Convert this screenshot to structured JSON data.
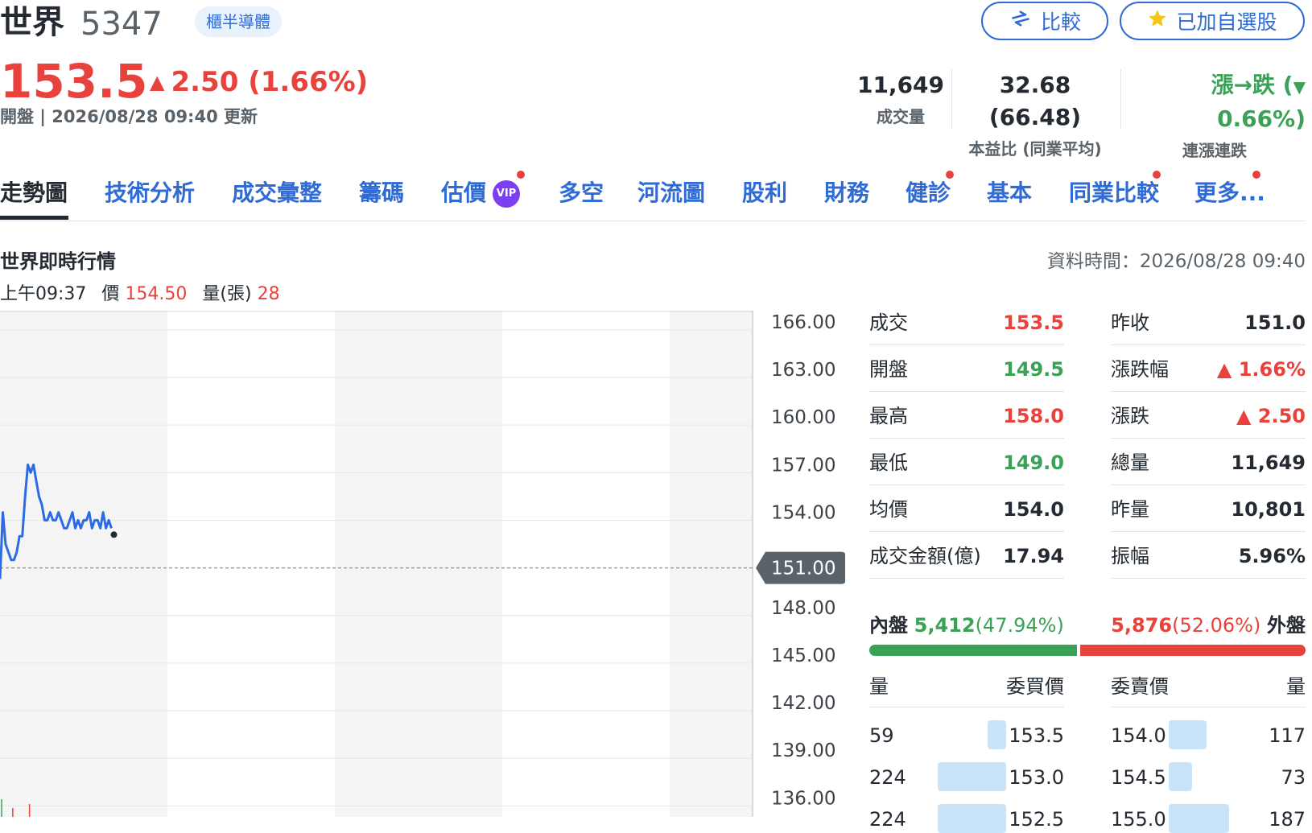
{
  "header": {
    "name": "世界",
    "code": "5347",
    "industry": "櫃半導體",
    "compare_label": "比較",
    "watchlist_label": "已加自選股",
    "price": "153.5",
    "change_arrow": "▲",
    "change": "2.50 (1.66%)",
    "update_text": "開盤 | 2026/08/28 09:40 更新",
    "volume_value": "11,649",
    "volume_label": "成交量",
    "pe_value": "32.68 (66.48)",
    "pe_label": "本益比 (同業平均)",
    "streak_value_prefix": "漲→跌 (",
    "streak_arrow": "▼",
    "streak_value_suffix": " 0.66%)",
    "streak_label": "連漲連跌"
  },
  "tabs": [
    {
      "label": "走勢圖"
    },
    {
      "label": "技術分析"
    },
    {
      "label": "成交彙整"
    },
    {
      "label": "籌碼"
    },
    {
      "label": "估價",
      "badge": "VIP"
    },
    {
      "label": "多空"
    },
    {
      "label": "河流圖"
    },
    {
      "label": "股利"
    },
    {
      "label": "財務"
    },
    {
      "label": "健診"
    },
    {
      "label": "基本"
    },
    {
      "label": "同業比較"
    },
    {
      "label": "更多..."
    }
  ],
  "section": {
    "title": "世界即時行情",
    "data_time": "資料時間：2026/08/28 09:40",
    "hover_time": "上午09:37",
    "hover_price_label": "價",
    "hover_price": "154.50",
    "hover_volume_label": "量(張)",
    "hover_volume": "28"
  },
  "quote": {
    "left": [
      {
        "label": "成交",
        "value": "153.5",
        "color": "#e8423d"
      },
      {
        "label": "開盤",
        "value": "149.5",
        "color": "#3aa157"
      },
      {
        "label": "最高",
        "value": "158.0",
        "color": "#e8423d"
      },
      {
        "label": "最低",
        "value": "149.0",
        "color": "#3aa157"
      },
      {
        "label": "均價",
        "value": "154.0",
        "color": "#232a31"
      },
      {
        "label": "成交金額(億)",
        "value": "17.94",
        "color": "#232a31"
      }
    ],
    "right": [
      {
        "label": "昨收",
        "value": "151.0",
        "color": "#232a31"
      },
      {
        "label": "漲跌幅",
        "value": "▲ 1.66%",
        "color": "#e8423d"
      },
      {
        "label": "漲跌",
        "value": "▲ 2.50",
        "color": "#e8423d"
      },
      {
        "label": "總量",
        "value": "11,649",
        "color": "#232a31"
      },
      {
        "label": "昨量",
        "value": "10,801",
        "color": "#232a31"
      },
      {
        "label": "振幅",
        "value": "5.96%",
        "color": "#232a31"
      }
    ]
  },
  "inout": {
    "in_label": "內盤",
    "in_value": "5,412",
    "in_pct": "(47.94%)",
    "out_value": "5,876",
    "out_pct": "(52.06%)",
    "out_label": "外盤",
    "in_fraction": 0.4794
  },
  "orderbook": {
    "headers": {
      "bid_qty": "量",
      "bid_price": "委買價",
      "ask_price": "委賣價",
      "ask_qty": "量"
    },
    "rows": [
      {
        "bid_qty": "59",
        "bid_price": "153.5",
        "ask_price": "154.0",
        "ask_qty": "117",
        "bid_frac": 0.16,
        "ask_frac": 0.42
      },
      {
        "bid_qty": "224",
        "bid_price": "153.0",
        "ask_price": "154.5",
        "ask_qty": "73",
        "bid_frac": 0.6,
        "ask_frac": 0.26
      },
      {
        "bid_qty": "224",
        "bid_price": "152.5",
        "ask_price": "155.0",
        "ask_qty": "187",
        "bid_frac": 0.6,
        "ask_frac": 0.67
      }
    ]
  },
  "colors": {
    "up": "#e8423d",
    "down": "#3aa157",
    "link": "#2f6bd5",
    "line": "#2b6be5"
  },
  "chart_data": {
    "type": "line",
    "yticks": [
      "166.00",
      "163.00",
      "160.00",
      "157.00",
      "154.00",
      "151.00",
      "148.00",
      "145.00",
      "142.00",
      "139.00",
      "136.00"
    ],
    "ylim": [
      134.7,
      166.6
    ],
    "reference_price": 151.0,
    "reference_label": "151.00",
    "x_minutes": [
      0,
      1,
      2,
      3,
      4,
      5,
      6,
      7,
      8,
      9,
      10,
      11,
      12,
      13,
      14,
      15,
      16,
      17,
      18,
      19,
      20,
      21,
      22,
      23,
      24,
      25,
      26,
      27,
      28,
      29,
      30,
      31,
      32,
      33,
      34,
      35,
      36,
      37,
      38,
      39,
      40
    ],
    "prices": [
      150.3,
      154.5,
      152.5,
      152.0,
      151.5,
      151.5,
      152.0,
      153.0,
      153.0,
      155.5,
      157.5,
      157.0,
      157.5,
      156.5,
      155.5,
      155.0,
      154.0,
      154.0,
      154.5,
      154.0,
      154.0,
      154.5,
      154.0,
      153.5,
      153.5,
      154.0,
      154.5,
      153.5,
      154.0,
      153.5,
      154.0,
      154.0,
      154.5,
      153.5,
      154.0,
      154.0,
      153.5,
      154.5,
      153.5,
      154.0,
      153.5
    ],
    "last_price": 153.5,
    "session_minutes": 270,
    "volume_ticks": [
      {
        "minute": 0,
        "volume": 440,
        "dir": "down"
      },
      {
        "minute": 4,
        "volume": 220,
        "dir": "up"
      },
      {
        "minute": 10,
        "volume": 320,
        "dir": "up"
      }
    ]
  }
}
